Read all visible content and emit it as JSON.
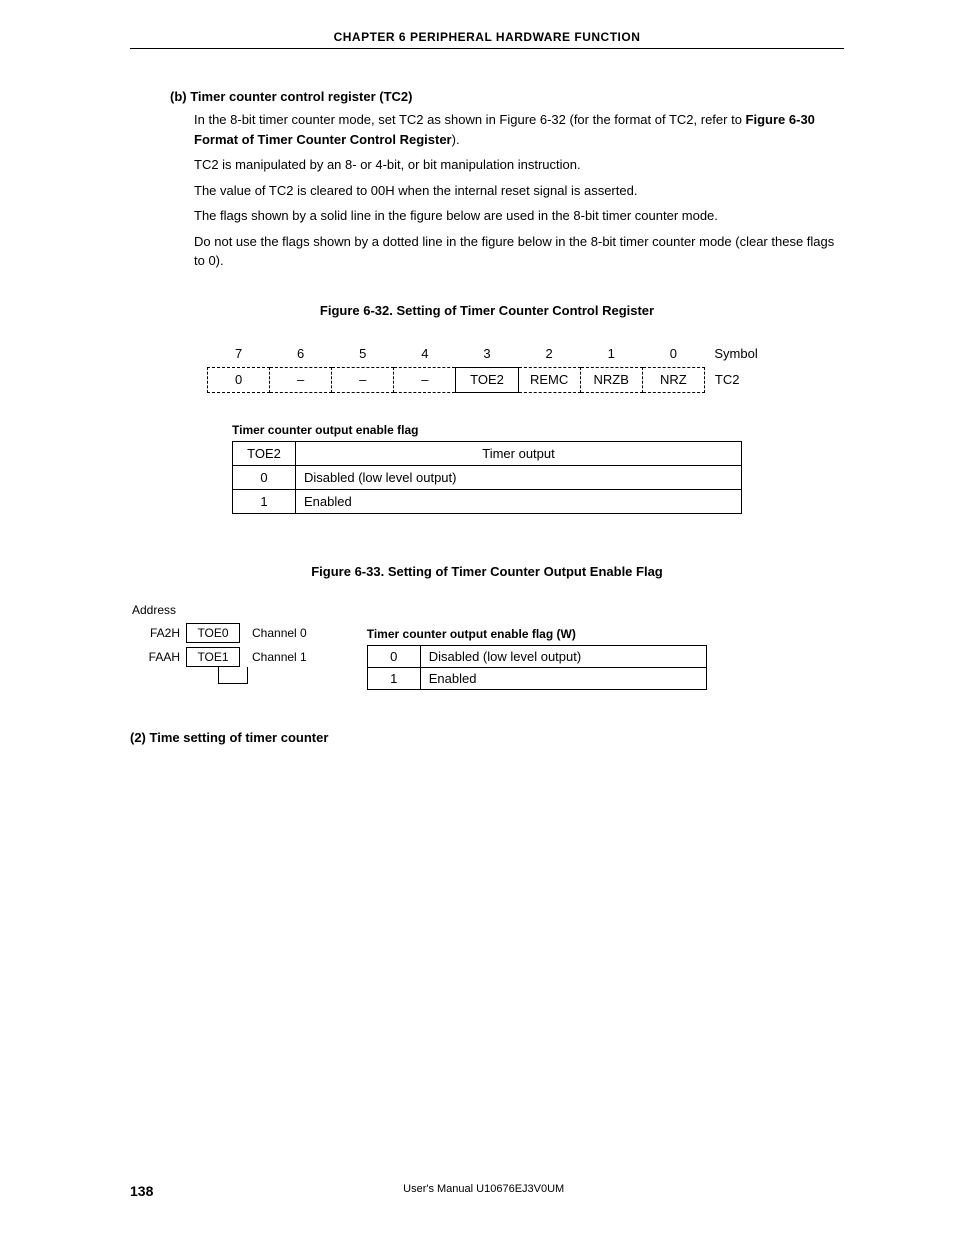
{
  "header": "CHAPTER 6   PERIPHERAL HARDWARE FUNCTION",
  "section_b": {
    "heading": "(b)  Timer counter control register (TC2)",
    "p1a": "In the 8-bit timer counter mode, set TC2 as shown in Figure 6-32 (for the format of TC2, refer to ",
    "p1b": "Figure 6-30 Format of Timer Counter Control Register",
    "p1c": ").",
    "p2": "TC2 is manipulated by an 8- or 4-bit, or bit manipulation instruction.",
    "p3": "The value of TC2 is cleared to 00H when the internal reset signal is asserted.",
    "p4": "The flags shown by a solid line in the figure below are used in the 8-bit timer counter mode.",
    "p5": "Do not use the flags shown by a dotted line in the figure below in the 8-bit timer counter mode (clear these flags to 0)."
  },
  "fig632_caption": "Figure 6-32.  Setting of Timer Counter Control Register",
  "reg": {
    "bits": [
      "7",
      "6",
      "5",
      "4",
      "3",
      "2",
      "1",
      "0"
    ],
    "symbol_hdr": "Symbol",
    "vals": [
      "0",
      "–",
      "–",
      "–",
      "TOE2",
      "REMC",
      "NRZB",
      "NRZ"
    ],
    "symbol_val": "TC2"
  },
  "toe2": {
    "title": "Timer counter output enable flag",
    "col0": "TOE2",
    "col1": "Timer output",
    "rows": [
      {
        "v": "0",
        "t": "Disabled (low level output)"
      },
      {
        "v": "1",
        "t": "Enabled"
      }
    ]
  },
  "fig633_caption": "Figure 6-33.  Setting of Timer Counter Output Enable Flag",
  "addr": {
    "label": "Address",
    "rows": [
      {
        "addr": "FA2H",
        "cell": "TOE0",
        "chan": "Channel 0"
      },
      {
        "addr": "FAAH",
        "cell": "TOE1",
        "chan": "Channel 1"
      }
    ]
  },
  "flagw": {
    "title": "Timer counter output enable flag (W)",
    "rows": [
      {
        "v": "0",
        "t": "Disabled (low level output)"
      },
      {
        "v": "1",
        "t": "Enabled"
      }
    ]
  },
  "sect2": "(2)  Time setting of timer counter",
  "footer": {
    "page": "138",
    "manual": "User's Manual  U10676EJ3V0UM"
  }
}
